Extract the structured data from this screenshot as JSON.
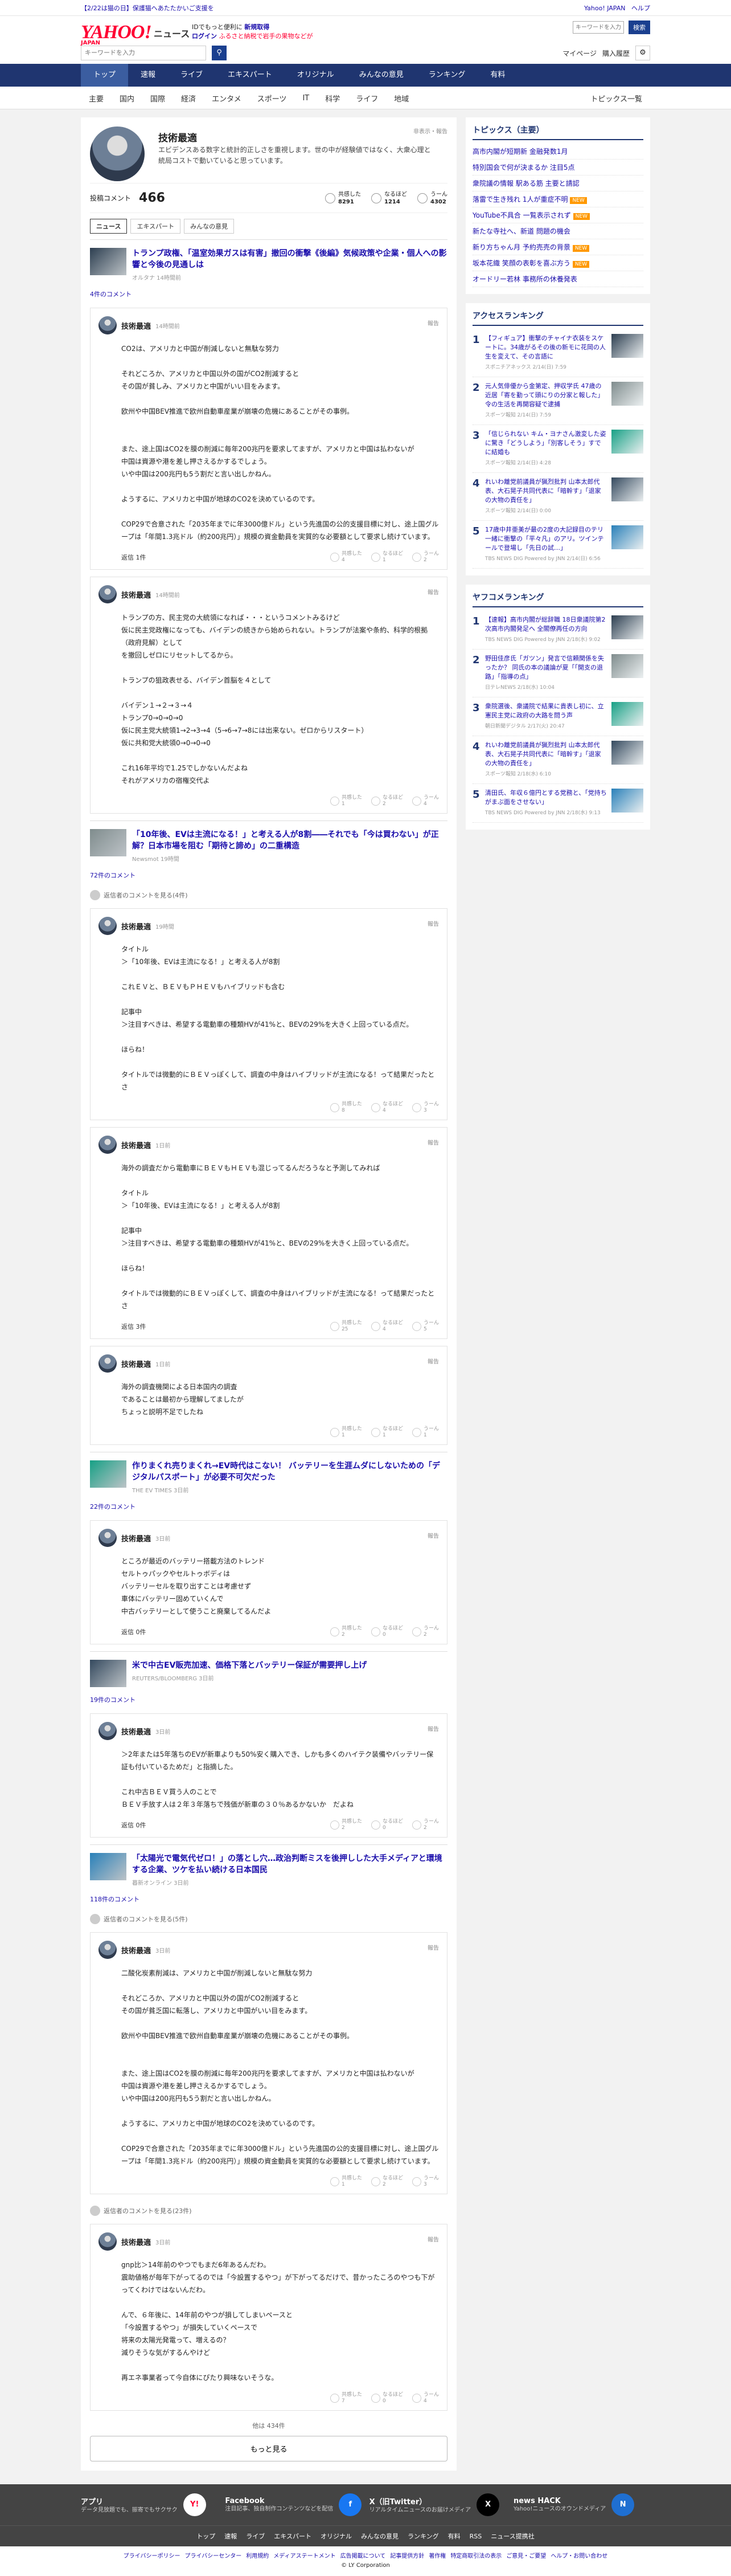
{
  "topbar": {
    "left_link": "【2/22は猫の日】保護猫へあたたかいご支援を",
    "right_links": [
      "Yahoo! JAPAN",
      "ヘルプ"
    ]
  },
  "header": {
    "logo": "YAHOO!",
    "logo_sub": "JAPAN",
    "service": "ニュース",
    "promo1": "IDでもっと便利に",
    "promo1_link": "新規取得",
    "promo2": "ログイン",
    "promo2_text": "ふるさと納税で岩手の果物などが",
    "search_placeholder": "キーワードを入力",
    "site_search_btn": "検索",
    "my_settings": "マイページ",
    "purchase": "購入履歴"
  },
  "nav_main": [
    {
      "label": "トップ",
      "active": true
    },
    {
      "label": "速報"
    },
    {
      "label": "ライブ"
    },
    {
      "label": "エキスパート"
    },
    {
      "label": "オリジナル"
    },
    {
      "label": "みんなの意見"
    },
    {
      "label": "ランキング"
    },
    {
      "label": "有料"
    }
  ],
  "nav_sub": [
    "主要",
    "国内",
    "国際",
    "経済",
    "エンタメ",
    "スポーツ",
    "IT",
    "科学",
    "ライフ",
    "地域"
  ],
  "nav_sub_right": "トピックス一覧",
  "profile": {
    "name": "技術最適",
    "bio": "エビデンスある数字と統計的正しさを重視します。世の中が経験値ではなく、大衆心理と統局コストで動いていると思っています。",
    "report": "非表示・報告",
    "comment_label": "投稿コメント",
    "comment_count": "466",
    "stats": [
      {
        "label": "共感した",
        "value": "8291"
      },
      {
        "label": "なるほど",
        "value": "1214"
      },
      {
        "label": "うーん",
        "value": "4302"
      }
    ],
    "tabs": [
      "ニュース",
      "エキスパート",
      "みんなの意見"
    ]
  },
  "threads": [
    {
      "title": "トランプ政権、「温室効果ガスは有害」撤回の衝撃《後編》気候政策や企業・個人への影響と今後の見通しは",
      "source": "オルタナ 14時間前",
      "comments_label": "4件のコメント",
      "hidden": "",
      "comments": [
        {
          "name": "技術最適",
          "time": "14時間前",
          "report": "報告",
          "body": "CO2は、アメリカと中国が削減しないと無駄な努力\n\nそれどころか、アメリカと中国以外の国がCO2削減すると\nその国が貧しみ、アメリカと中国がいい目をみます。\n\n欧州や中国BEV推進で欧州自動車産業が崩壊の危機にあることがその事例。\n\n\nまた、途上国はCO2を膜の削減に毎年200兆円を要求してますが、アメリカと中国は払わないが\n中国は資源や港を差し押さえるかするでしょう。\nいや中国は200兆円も5う割だと言い出しかねん。\n\nようするに、アメリカと中国が地球のCO2を決めているのです。\n\nCOP29で合意された「2035年までに年3000億ドル」という先進国の公的支援目標に対し、途上国グループは「年間1.3兆ドル（約200兆円）」規模の資金動員を実質的な必要額として要求し続けています。",
          "reply_label": "返信 1件",
          "reactions": [
            "4",
            "1",
            "2"
          ]
        },
        {
          "name": "技術最適",
          "time": "14時間前",
          "report": "報告",
          "body": "トランプの方、民主党の大統領になれば・・・というコメントみるけど\n仮に民主党政権になっても、バイデンの続きから始められない。トランプが法案や条約、科学的根拠（政府見解）として\nを撤回しゼロにリセットしてるから。\n\nトランプの狙政表せる、バイデン首脳を４として\n\nバイデン１→２→３→４\nトランプ0→0→0→0\n仮に民主党大統領1→2→3→4（5→6→7→8には出来ない。ゼロからリスタート）\n仮に共和党大統領0→0→0→0\n\nこれ16年平均で1.25でしかないんだよね\nそれがアメリカの宿権交代よ",
          "reply_label": "",
          "reactions": [
            "1",
            "2",
            "4"
          ]
        }
      ]
    },
    {
      "title": "「10年後、EVは主流になる！」と考える人が8割――それでも「今は買わない」が正解？日本市場を阻む「期待と諦め」の二重構造",
      "source": "Newsmot 19時間",
      "comments_label": "72件のコメント",
      "hidden": "返信者のコメントを見る(4件)",
      "comments": [
        {
          "name": "技術最適",
          "time": "19時間",
          "report": "報告",
          "body": "タイトル\n＞「10年後、EVは主流になる！」と考える人が8割\n\nこれＥＶと、ＢＥＶもＰＨＥＶもハイブリッドも含む\n\n記事中\n＞注目すべきは、希望する電動車の種類HVが41%と、BEVの29%を大きく上回っている点だ。\n\nほらね！\n\nタイトルでは微動的にＢＥＶっぽくして、調査の中身はハイブリッドが主流になる！って結果だったとさ",
          "reply_label": "",
          "reactions": [
            "8",
            "4",
            "3"
          ]
        },
        {
          "name": "技術最適",
          "time": "1日前",
          "report": "報告",
          "body": "海外の調査だから電動車にＢＥＶもＨＥＶも混じってるんだろうなと予測してみれば\n\nタイトル\n＞「10年後、EVは主流になる！」と考える人が8割\n\n記事中\n＞注目すべきは、希望する電動車の種類HVが41%と、BEVの29%を大きく上回っている点だ。\n\nほらね！\n\nタイトルでは微動的にＢＥＶっぽくして、調査の中身はハイブリッドが主流になる！って結果だったとさ",
          "reply_label": "返信 3件",
          "reactions": [
            "25",
            "4",
            "5"
          ]
        },
        {
          "name": "技術最適",
          "time": "1日前",
          "report": "報告",
          "body": "海外の調査機関による日本国内の調査\nであることは最初から理解してましたが\nちょっと説明不足でしたね",
          "reply_label": "",
          "reactions": [
            "1",
            "1",
            "1"
          ]
        }
      ]
    },
    {
      "title": "作りまくれ売りまくれ→EV時代はこない！ バッテリーを生涯ムダにしないための「デジタルパスポート」が必要不可欠だった",
      "source": "THE EV TIMES 3日前",
      "comments_label": "22件のコメント",
      "hidden": "",
      "comments": [
        {
          "name": "技術最適",
          "time": "3日前",
          "report": "報告",
          "body": "ところが最近のバッテリー搭載方法のトレンド\nセルトゥパックやセルトゥボディは\nバッテリーセルを取り出すことは考慮せず\n車体にバッテリー固めていくんで\n中古バッテリーとして使うこと廃棄してるんだよ",
          "reply_label": "返信 0件",
          "reactions": [
            "2",
            "0",
            "2"
          ]
        }
      ]
    },
    {
      "title": "米で中古EV販売加速、価格下落とバッテリー保証が需要押し上げ",
      "source": "REUTERS/BLOOMBERG 3日前",
      "comments_label": "19件のコメント",
      "hidden": "",
      "comments": [
        {
          "name": "技術最適",
          "time": "3日前",
          "report": "報告",
          "body": "＞2年または5年落ちのEVが新車よりも50%安く購入でき、しかも多くのハイテク装備やバッテリー保証も付いているためだ」と指摘した。\n\nこれ中古ＢＥＶ買う人のことで\nＢＥＶ手放す人は２年３年落ちで残価が新車の３０％あるかないか　だよね",
          "reply_label": "返信 0件",
          "reactions": [
            "2",
            "0",
            "2"
          ]
        }
      ]
    },
    {
      "title": "「太陽光で電気代ゼロ！」の落とし穴…政治判断ミスを後押しした大手メディアと環境する企業、ツケを払い続ける日本国民",
      "source": "暮新オンライン 3日前",
      "comments_label": "118件のコメント",
      "hidden": "返信者のコメントを見る(5件)",
      "comments": [
        {
          "name": "技術最適",
          "time": "3日前",
          "report": "報告",
          "body": "二酸化炭素削減は、アメリカと中国が削減しないと無駄な努力\n\nそれどころか、アメリカと中国以外の国がCO2削減すると\nその国が貧乏国に転落し、アメリカと中国がいい目をみます。\n\n欧州や中国BEV推進で欧州自動車産業が崩壊の危機にあることがその事例。\n\n\nまた、途上国はCO2を膜の削減に毎年200兆円を要求してますが、アメリカと中国は払わないが\n中国は資源や港を差し押さえるかするでしょう。\nいや中国は200兆円も5う割だと言い出しかねん。\n\nようするに、アメリカと中国が地球のCO2を決めているのです。\n\nCOP29で合意された「2035年までに年3000億ドル」という先進国の公的支援目標に対し、途上国グループは「年間1.3兆ドル（約200兆円）」規模の資金動員を実質的な必要額として要求し続けています。",
          "reply_label": "",
          "reactions": [
            "1",
            "2",
            "3"
          ]
        }
      ]
    },
    {
      "title": "",
      "source": "",
      "comments_label": "",
      "hidden": "返信者のコメントを見る(23件)",
      "comments": [
        {
          "name": "技術最適",
          "time": "3日前",
          "report": "報告",
          "body": "gnp比＞14年前のやつでもまだ6年あるんだわ。\n震助値格が毎年下がってるのでは「今設置するやつ」が下がってるだけで、昔かったころのやつも下がってくわけではないんだわ。\n\nんで、６年後に、14年前のやつが損してしまいペースと\n「今設置するやつ」が損失していくペースで\n将来の太陽光発電って、増えるの？\n減りそうな気がするんやけど\n\n再エネ事業者って今自体にぴたり興味ないそうな。",
          "reply_label": "",
          "reactions": [
            "7",
            "0",
            "4"
          ]
        }
      ]
    }
  ],
  "more": {
    "count": "他は 434件",
    "button": "もっと見る"
  },
  "sidebar": {
    "topics_title": "トピックス（主要）",
    "topics": [
      {
        "text": "高市内閣が短期新 金融発数1月",
        "tag": ""
      },
      {
        "text": "特別国会で何が決まるか 注目5点",
        "tag": ""
      },
      {
        "text": "衆院議の情報 駅ある筋 主要と請認",
        "tag": ""
      },
      {
        "text": "落雷で生き残れ 1人が重症不明",
        "tag": "NEW"
      },
      {
        "text": "YouTube不具合 一覧表示されず",
        "tag": "NEW"
      },
      {
        "text": "新たな寺社へ、新道 問題の機会",
        "tag": ""
      },
      {
        "text": "新り方ちゃん月 予約売売の背景",
        "tag": "NEW"
      },
      {
        "text": "坂本花織 笑顔の表彰を喜ぶ方う",
        "tag": "NEW"
      },
      {
        "text": "オードリー若林 事務所の休養発表",
        "tag": ""
      }
    ],
    "access_title": "アクセスランキング",
    "access": [
      {
        "n": "1",
        "text": "【フィギュア】衝撃のチャイナ衣装をスケートに。34歳がるその後の新モに花岡の人生を変えて、その言語に",
        "meta": "スポニチアネックス 2/14(日) 7:59"
      },
      {
        "n": "2",
        "text": "元人気俳優から金第定、押収学氏 47歳の近居「寄を勤って頭にりの分家と報した」令の生活を再開容疑で逮捕",
        "meta": "スポーツ報知 2/14(日) 7:59"
      },
      {
        "n": "3",
        "text": "「信じられない キム・ヨナさん激変した姿に驚き「どうしよう」「別客しそう」すでに結婚も",
        "meta": "スポーツ報知 2/14(日) 4:28"
      },
      {
        "n": "4",
        "text": "れいわ離党前議員が猟烈批判 山本太郎代表、大石晃子共同代表に「暗幹す」「退家の大物の責任を」",
        "meta": "スポーツ報知 2/14(日) 0:00"
      },
      {
        "n": "5",
        "text": "17歳中井亜美が最の2度の大記録目のテリ一緒に衝撃の「平々凡」のアリ。ツインテールで登場し「先日の試…」",
        "meta": "TBS NEWS DIG Powered by JNN 2/14(日) 6:56"
      }
    ],
    "yahoo_title": "ヤフコメランキング",
    "yahoo": [
      {
        "n": "1",
        "text": "【速報】高市内閣が総辞職 18日衆議院第2次高市内閣発足へ 全閣僚再任の方向",
        "meta": "TBS NEWS DIG Powered by JNN 2/18(水) 9:02"
      },
      {
        "n": "2",
        "text": "野田佳彦氏「ガツン」発言で信頼関係を失ったか？ 同氏の本の議論が夏「「開支の退路」「指導の点」",
        "meta": "日テレNEWS 2/18(水) 10:04"
      },
      {
        "n": "3",
        "text": "衆院選後、衆議院で結果に貴表し初に、立憲民主党に政府の大路を問う声",
        "meta": "朝日新聞デジタル 2/17(火) 20:47"
      },
      {
        "n": "4",
        "text": "れいわ離党前議員が猟烈批判 山本太郎代表、大石晃子共同代表に「暗幹す」「退家の大物の責任を」",
        "meta": "スポーツ報知 2/18(水) 6:10"
      },
      {
        "n": "5",
        "text": "清田氏、年収６億円とする党務と、「党持ちがまぶ面をさせない」",
        "meta": "TBS NEWS DIG Powered by JNN 2/18(水) 9:13"
      }
    ]
  },
  "footer": {
    "cols": [
      {
        "title": "アプリ",
        "desc": "データ見放題でも、振寄でもサクサク",
        "icon": "Y!"
      },
      {
        "title": "Facebook",
        "desc": "注目記事、独自制作コンテンツなどを配信",
        "icon": "f"
      },
      {
        "title": "X（旧Twitter）",
        "desc": "リアルタイムニュースのお届けメディア",
        "icon": "X"
      },
      {
        "title": "news HACK",
        "desc": "Yahoo!ニュースのオウンドメディア",
        "icon": "N"
      }
    ],
    "nav": [
      "トップ",
      "速報",
      "ライブ",
      "エキスパート",
      "オリジナル",
      "みんなの意見",
      "ランキング",
      "有料",
      "RSS",
      "ニュース提携社"
    ],
    "legal": [
      "プライバシーポリシー",
      "プライバシーセンター",
      "利用規約",
      "メディアステートメント",
      "広告掲載について",
      "記事提供方針",
      "著作権",
      "特定商取引法の表示",
      "ご意見・ご要望",
      "ヘルプ・お問い合わせ"
    ],
    "copyright": "© LY Corporation"
  },
  "icons": {
    "thumb_colors": [
      "#2c3e50",
      "#7f8c8d",
      "#16a085",
      "#34495e",
      "#2980b9"
    ]
  }
}
